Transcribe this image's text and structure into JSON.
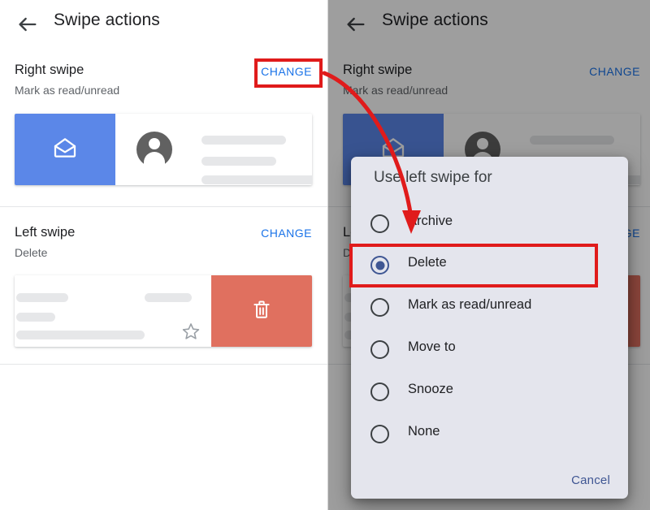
{
  "appbar": {
    "back_icon": "arrow-left-icon",
    "title": "Swipe actions"
  },
  "settings": {
    "right_swipe": {
      "title": "Right swipe",
      "subtitle": "Mark as read/unread",
      "change_label": "CHANGE",
      "preview_action_icon": "open-envelope-icon",
      "preview_action_color": "#5b87e8"
    },
    "left_swipe": {
      "title": "Left swipe",
      "subtitle": "Delete",
      "change_label": "CHANGE",
      "preview_action_icon": "trash-icon",
      "preview_action_color": "#e0705f",
      "star_icon": "star-outline-icon"
    }
  },
  "dialog": {
    "title": "Use left swipe for",
    "options": [
      {
        "label": "Archive",
        "selected": false
      },
      {
        "label": "Delete",
        "selected": true
      },
      {
        "label": "Mark as read/unread",
        "selected": false
      },
      {
        "label": "Move to",
        "selected": false
      },
      {
        "label": "Snooze",
        "selected": false
      },
      {
        "label": "None",
        "selected": false
      }
    ],
    "cancel_label": "Cancel",
    "accent_color": "#3f5693",
    "background_color": "#e4e5ed"
  },
  "annotations": {
    "color": "#e01b1b",
    "highlight_change": "CHANGE",
    "highlight_option": "Delete",
    "arrow": "curved-arrow-annotation"
  },
  "link_color": "#1a73e8"
}
